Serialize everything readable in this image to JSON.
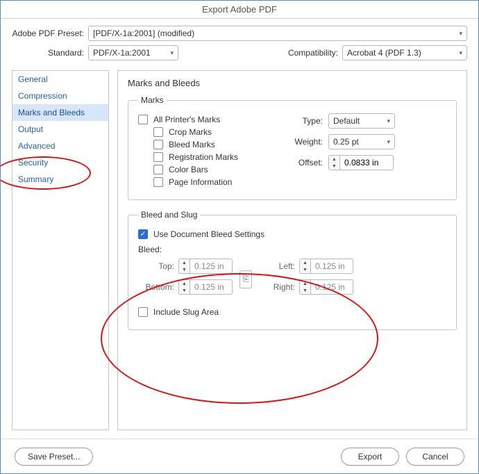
{
  "window": {
    "title": "Export Adobe PDF"
  },
  "header": {
    "preset_label": "Adobe PDF Preset:",
    "preset_value": "[PDF/X-1a:2001] (modified)",
    "standard_label": "Standard:",
    "standard_value": "PDF/X-1a:2001",
    "compat_label": "Compatibility:",
    "compat_value": "Acrobat 4 (PDF 1.3)"
  },
  "sidebar": {
    "items": [
      {
        "label": "General"
      },
      {
        "label": "Compression"
      },
      {
        "label": "Marks and Bleeds"
      },
      {
        "label": "Output"
      },
      {
        "label": "Advanced"
      },
      {
        "label": "Security"
      },
      {
        "label": "Summary"
      }
    ],
    "selected_index": 2
  },
  "main": {
    "title": "Marks and Bleeds",
    "marks": {
      "legend": "Marks",
      "all_label": "All Printer's Marks",
      "crop_label": "Crop Marks",
      "bleed_label": "Bleed Marks",
      "reg_label": "Registration Marks",
      "color_label": "Color Bars",
      "page_label": "Page Information",
      "type_label": "Type:",
      "type_value": "Default",
      "weight_label": "Weight:",
      "weight_value": "0.25 pt",
      "offset_label": "Offset:",
      "offset_value": "0.0833 in"
    },
    "bleedslug": {
      "legend": "Bleed and Slug",
      "use_doc_label": "Use Document Bleed Settings",
      "use_doc_checked": true,
      "bleed_label": "Bleed:",
      "top_label": "Top:",
      "top_value": "0.125 in",
      "bottom_label": "Bottom:",
      "bottom_value": "0.125 in",
      "left_label": "Left:",
      "left_value": "0.125 in",
      "right_label": "Right:",
      "right_value": "0.125 in",
      "include_slug_label": "Include Slug Area"
    }
  },
  "footer": {
    "save_preset": "Save Preset...",
    "export": "Export",
    "cancel": "Cancel"
  }
}
